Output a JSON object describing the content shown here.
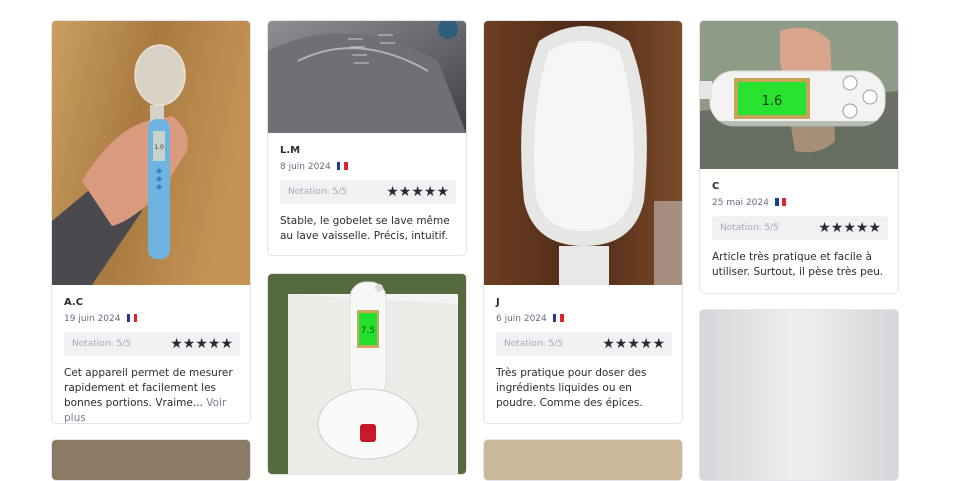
{
  "reviews": [
    {
      "author": "A.C",
      "date": "19 juin 2024",
      "rating_label": "Notation: 5/5",
      "stars": "★★★★★",
      "rating": 5,
      "text": "Cet appareil permet de mesurer rapidement et facilement les bonnes portions. Vraime...",
      "more": "Voir plus",
      "display_text": "1.0"
    },
    {
      "author": "L.M",
      "date": "8 juin 2024",
      "rating_label": "Notation: 5/5",
      "stars": "★★★★★",
      "rating": 5,
      "text": "Stable, le gobelet se lave même au lave vaisselle. Précis, intuitif."
    },
    {
      "author": "J",
      "date": "6 juin 2024",
      "rating_label": "Notation: 5/5",
      "stars": "★★★★★",
      "rating": 5,
      "text": "Très pratique pour doser des ingrédients liquides ou en poudre. Comme des épices."
    },
    {
      "author": "C",
      "date": "25 mai 2024",
      "rating_label": "Notation: 5/5",
      "stars": "★★★★★",
      "rating": 5,
      "text": "Article très pratique et facile à utiliser. Surtout, il pèse très peu.",
      "display_text": "1.6"
    },
    {
      "display_text": "7.5"
    }
  ],
  "flag_colors": [
    "#1f3d99",
    "#ffffff",
    "#e0262d"
  ],
  "star_color": "#2b2b36"
}
